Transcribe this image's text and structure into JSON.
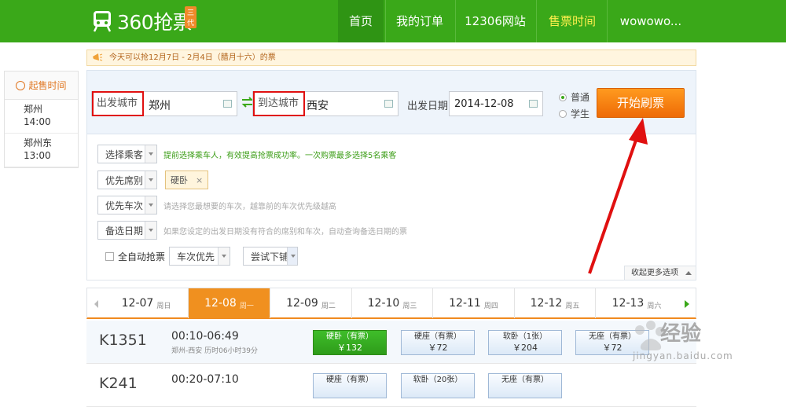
{
  "header": {
    "brand": "360抢票",
    "generation_badge": "三代",
    "nav": {
      "home": "首页",
      "orders": "我的订单",
      "site_12306": "12306网站",
      "sale_time": "售票时间",
      "user": "wowowo..."
    }
  },
  "sidebar": {
    "title": "起售时间",
    "items": [
      {
        "station": "郑州",
        "time": "14:00"
      },
      {
        "station": "郑州东",
        "time": "13:00"
      }
    ]
  },
  "notice": "今天可以抢12月7日 - 2月4日（腊月十六）的票",
  "search": {
    "from_label": "出发城市",
    "from_value": "郑州",
    "to_label": "到达城市",
    "to_value": "西安",
    "date_label": "出发日期",
    "date_value": "2014-12-08",
    "radio_normal": "普通",
    "radio_student": "学生",
    "start_button": "开始刷票"
  },
  "options": {
    "passenger_select": "选择乘客",
    "passenger_hint": "提前选择乘车人，有效提高抢票成功率。一次购票最多选择5名乘客",
    "seat_select": "优先席别",
    "seat_tag": "硬卧",
    "seat_tag_close": "×",
    "train_select": "优先车次",
    "train_hint": "请选择您最想要的车次，越靠前的车次优先级越高",
    "date_select": "备选日期",
    "date_hint": "如果您设定的出发日期没有符合的席别和车次，自动查询备选日期的票",
    "auto_label": "全自动抢票",
    "auto_mode": "车次优先",
    "try_mode": "尝试下铺",
    "more_options": "收起更多选项"
  },
  "dates": [
    {
      "date": "12-07",
      "weekday": "周日"
    },
    {
      "date": "12-08",
      "weekday": "周一"
    },
    {
      "date": "12-09",
      "weekday": "周二"
    },
    {
      "date": "12-10",
      "weekday": "周三"
    },
    {
      "date": "12-11",
      "weekday": "周四"
    },
    {
      "date": "12-12",
      "weekday": "周五"
    },
    {
      "date": "12-13",
      "weekday": "周六"
    }
  ],
  "trains": [
    {
      "number": "K1351",
      "time": "00:10-06:49",
      "route": "郑州-西安  历时06小时39分",
      "seats": [
        {
          "name": "硬卧（有票）",
          "price": "￥132"
        },
        {
          "name": "硬座（有票）",
          "price": "￥72"
        },
        {
          "name": "软卧（1张）",
          "price": "￥204"
        },
        {
          "name": "无座（有票）",
          "price": "￥72"
        }
      ]
    },
    {
      "number": "K241",
      "time": "00:20-07:10",
      "seats": [
        {
          "name": "硬座（有票）"
        },
        {
          "name": "软卧（20张）"
        },
        {
          "name": "无座（有票）"
        }
      ]
    }
  ],
  "watermark": {
    "text": "经验",
    "url": "jingyan.baidu.com"
  },
  "colors": {
    "brand_green": "#3aa819",
    "accent_orange": "#f0901f",
    "annotation_red": "#e01010"
  }
}
